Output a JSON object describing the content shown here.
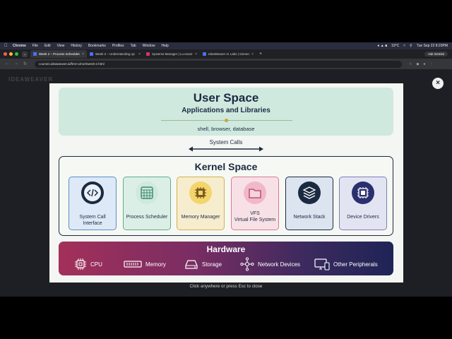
{
  "menubar": {
    "app": "Chrome",
    "items": [
      "File",
      "Edit",
      "View",
      "History",
      "Bookmarks",
      "Profiles",
      "Tab",
      "Window",
      "Help"
    ],
    "weather": "19°C",
    "clock": "Tue Sep 22  8:20PM"
  },
  "tabs": [
    {
      "title": "Week 2 – Process Scheduler",
      "color": "#4c6fff",
      "active": true
    },
    {
      "title": "Week 2 – Understanding op",
      "color": "#4c6fff",
      "active": false
    },
    {
      "title": "Systems Manager | Lu-exact",
      "color": "#d6336c",
      "active": false
    },
    {
      "title": "IdeaWeaver AI Labs | Generat",
      "color": "#4c6fff",
      "active": false
    }
  ],
  "toolbar": {
    "ask_gemini": "Ask Gemini"
  },
  "address": {
    "url": "courses.ideaweaver.ai/first-cohort/week-2.html"
  },
  "background": {
    "logo": "IDEAWEAVER"
  },
  "diagram": {
    "user_space": {
      "title": "User Space",
      "subtitle": "Applications and Libraries",
      "examples": "shell, browser, database"
    },
    "system_calls": "System Calls",
    "kernel_space": {
      "title": "Kernel Space",
      "components": [
        {
          "line1": "System Call Interface",
          "line2": "",
          "icon": "code-icon",
          "bg": "#dde9f6",
          "border": "#5b8fc9",
          "circle": "#1b2a41"
        },
        {
          "line1": "Process Scheduler",
          "line2": "",
          "icon": "grid-calendar-icon",
          "bg": "#dcefe6",
          "border": "#5fae8b",
          "circle": "#cfe9df"
        },
        {
          "line1": "Memory Manager",
          "line2": "",
          "icon": "chip-icon",
          "bg": "#f6edcf",
          "border": "#d4b04a",
          "circle": "#f3d56b"
        },
        {
          "line1": "VFS",
          "line2": "Virtual File System",
          "icon": "folder-icon",
          "bg": "#f8e1e6",
          "border": "#d77c95",
          "circle": "#f1b8c8"
        },
        {
          "line1": "Network Stack",
          "line2": "",
          "icon": "layers-icon",
          "bg": "#dbe4ef",
          "border": "#1b2a41",
          "circle": "#1b2a41"
        },
        {
          "line1": "Device Drivers",
          "line2": "",
          "icon": "cpu-icon",
          "bg": "#e3e4f2",
          "border": "#7b7fb8",
          "circle": "#2b2f6e"
        }
      ]
    },
    "hardware": {
      "title": "Hardware",
      "items": [
        {
          "label": "CPU",
          "icon": "cpu-chip-icon"
        },
        {
          "label": "Memory",
          "icon": "ram-icon"
        },
        {
          "label": "Storage",
          "icon": "disk-icon"
        },
        {
          "label": "Network Devices",
          "icon": "network-icon"
        },
        {
          "label": "Other Peripherals",
          "icon": "monitor-icon"
        }
      ]
    }
  },
  "hint": "Click anywhere or press Esc to close"
}
